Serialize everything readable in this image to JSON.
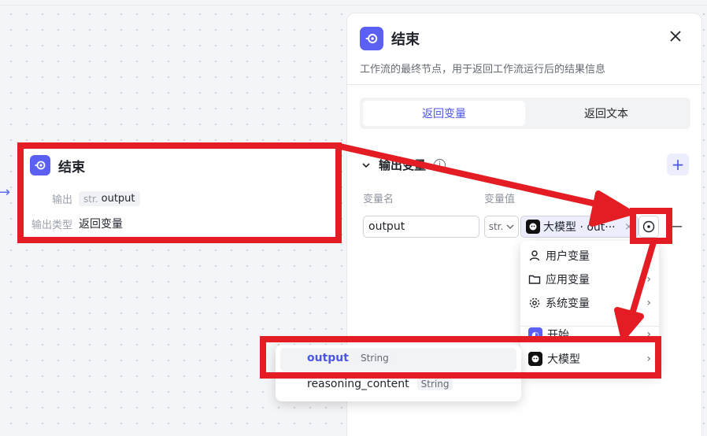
{
  "canvas": {
    "node": {
      "title": "结束",
      "output_label": "输出",
      "output_chip_type": "str.",
      "output_chip_name": "output",
      "output_type_label": "输出类型",
      "output_type_value": "返回变量"
    }
  },
  "panel": {
    "title": "结束",
    "description": "工作流的最终节点，用于返回工作流运行后的结果信息",
    "tabs": [
      {
        "label": "返回变量",
        "active": true
      },
      {
        "label": "返回文本",
        "active": false
      }
    ],
    "section_title": "输出变量",
    "col_name": "变量名",
    "col_value": "变量值",
    "row": {
      "name_value": "output",
      "type_value": "str.",
      "ref_value": "大模型 · out···"
    }
  },
  "dropdown": {
    "items": [
      {
        "label": "用户变量",
        "icon": "user-icon"
      },
      {
        "label": "应用变量",
        "icon": "folder-icon"
      },
      {
        "label": "系统变量",
        "icon": "gear-icon"
      },
      {
        "label": "开始",
        "icon": "start-node-icon"
      },
      {
        "label": "大模型",
        "icon": "llm-node-icon"
      }
    ]
  },
  "submenu": {
    "items": [
      {
        "name": "output",
        "type": "String",
        "selected": true
      },
      {
        "name": "reasoning_content",
        "type": "String",
        "selected": false
      }
    ]
  },
  "colors": {
    "accent": "#5b5ff2",
    "annotation_red": "#e41c23"
  }
}
